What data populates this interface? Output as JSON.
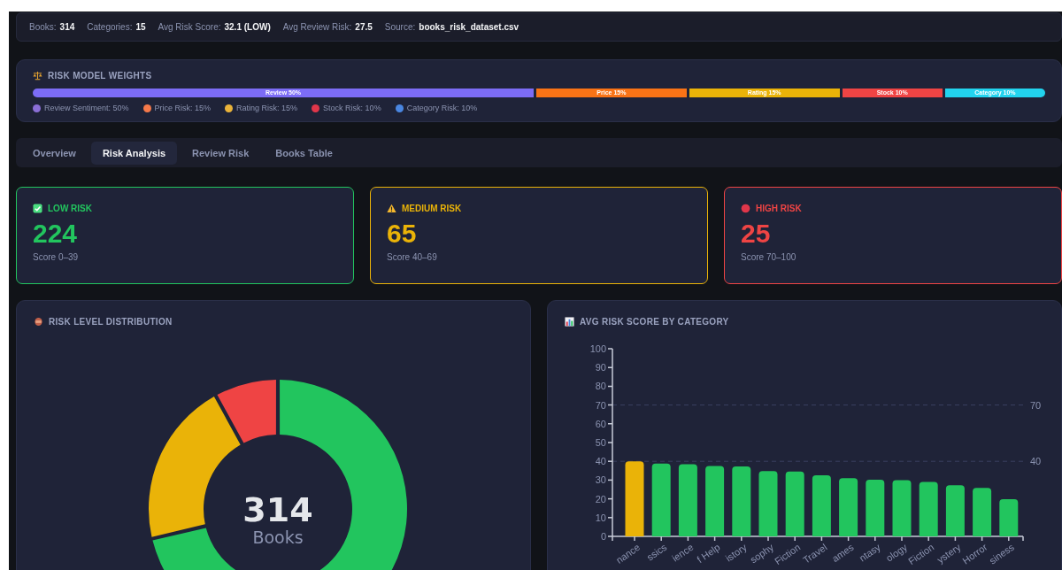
{
  "summary": [
    {
      "label": "Books:",
      "value": "314"
    },
    {
      "label": "Categories:",
      "value": "15"
    },
    {
      "label": "Avg Risk Score:",
      "value": "32.1 (LOW)"
    },
    {
      "label": "Avg Review Risk:",
      "value": "27.5"
    },
    {
      "label": "Source:",
      "value": "books_risk_dataset.csv"
    }
  ],
  "weights": {
    "title": "RISK MODEL WEIGHTS",
    "segments": [
      {
        "label": "Review 50%",
        "color": "#7c6cf6"
      },
      {
        "label": "Price 15%",
        "color": "#f97316"
      },
      {
        "label": "Rating 15%",
        "color": "#eab308"
      },
      {
        "label": "Stock 10%",
        "color": "#ef4444"
      },
      {
        "label": "Category 10%",
        "color": "#22d3ee"
      }
    ],
    "legend": [
      {
        "label": "Review Sentiment: 50%",
        "color": "#8b6fd6"
      },
      {
        "label": "Price Risk: 15%",
        "color": "#f5794a"
      },
      {
        "label": "Rating Risk: 15%",
        "color": "#eab33a"
      },
      {
        "label": "Stock Risk: 10%",
        "color": "#e0364a"
      },
      {
        "label": "Category Risk: 10%",
        "color": "#4a86e0"
      }
    ]
  },
  "tabs": [
    {
      "label": "Overview",
      "selected": false
    },
    {
      "label": "Risk Analysis",
      "selected": true
    },
    {
      "label": "Review Risk",
      "selected": false
    },
    {
      "label": "Books Table",
      "selected": false
    }
  ],
  "risk_cards": [
    {
      "kind": "low",
      "title": "LOW RISK",
      "count": "224",
      "range": "Score 0–39",
      "color": "#22c55e"
    },
    {
      "kind": "medium",
      "title": "MEDIUM RISK",
      "count": "65",
      "range": "Score 40–69",
      "color": "#eab308"
    },
    {
      "kind": "high",
      "title": "HIGH RISK",
      "count": "25",
      "range": "Score 70–100",
      "color": "#ef4444"
    }
  ],
  "distribution": {
    "title": "RISK LEVEL DISTRIBUTION",
    "center_value": "314",
    "center_label": "Books",
    "chart_data": {
      "type": "donut",
      "values": [
        71.3,
        20.7,
        8.0
      ]
    }
  },
  "category_chart": {
    "title": "AVG RISK SCORE BY CATEGORY",
    "chart_data": {
      "type": "bar",
      "categories": [
        "nance",
        "ssics",
        "ience",
        "f Help",
        "istory",
        "sophy",
        "Fiction",
        "Travel",
        "ames",
        "ntasy",
        "ology",
        "Fiction",
        "ystery",
        "Horror",
        "siness"
      ],
      "values": [
        40,
        38.8,
        38.5,
        37.5,
        37.3,
        34.8,
        34.5,
        32.5,
        31,
        30.2,
        30,
        29,
        27.2,
        25.8,
        19.8
      ],
      "colors": [
        "#eab308",
        "#22c55e",
        "#22c55e",
        "#22c55e",
        "#22c55e",
        "#22c55e",
        "#22c55e",
        "#22c55e",
        "#22c55e",
        "#22c55e",
        "#22c55e",
        "#22c55e",
        "#22c55e",
        "#22c55e",
        "#22c55e"
      ],
      "ylim": [
        0,
        100
      ],
      "yticks": [
        0,
        10,
        20,
        30,
        40,
        50,
        60,
        70,
        80,
        90,
        100
      ]
    },
    "threshold_labels": [
      "70",
      "40"
    ]
  }
}
